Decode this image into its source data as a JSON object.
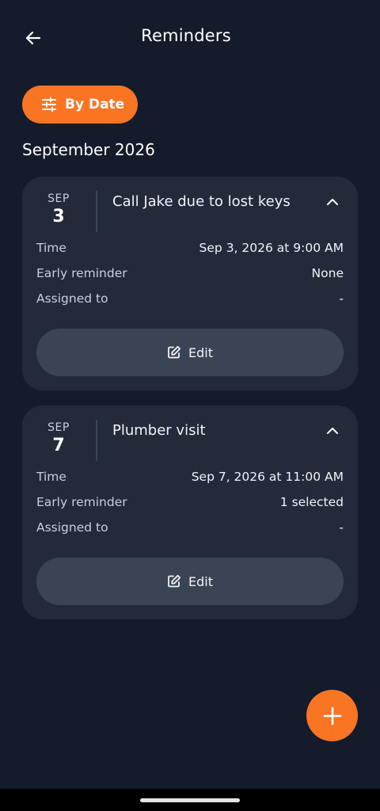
{
  "header": {
    "title": "Reminders",
    "back_icon": "arrow-left-icon"
  },
  "filter": {
    "label": "By Date",
    "icon": "sliders-icon"
  },
  "group": {
    "month_label": "September 2026"
  },
  "reminders": [
    {
      "month": "SEP",
      "day": "3",
      "title": "Call Jake due to lost keys",
      "time_label": "Time",
      "time_value": "Sep 3, 2026 at 9:00 AM",
      "early_label": "Early reminder",
      "early_value": "None",
      "assigned_label": "Assigned to",
      "assigned_value": "-",
      "edit_label": "Edit"
    },
    {
      "month": "SEP",
      "day": "7",
      "title": "Plumber visit",
      "time_label": "Time",
      "time_value": "Sep 7, 2026 at 11:00 AM",
      "early_label": "Early reminder",
      "early_value": "1 selected",
      "assigned_label": "Assigned to",
      "assigned_value": "-",
      "edit_label": "Edit"
    }
  ],
  "fab": {
    "icon": "plus-icon"
  },
  "colors": {
    "background": "#141b2b",
    "card": "#232b3b",
    "accent": "#f97523",
    "button": "#3b4454"
  }
}
